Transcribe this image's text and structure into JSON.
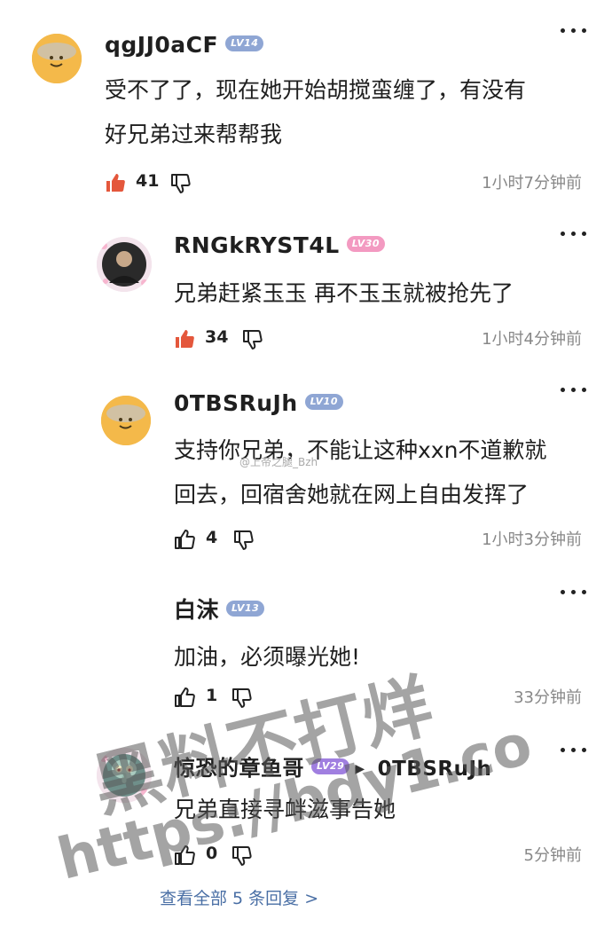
{
  "colors": {
    "lv14": "#8fa6d4",
    "lv30": "#f39ac1",
    "lv10": "#8fa6d4",
    "lv13": "#8fa6d4",
    "lv29": "#a07fe0",
    "like_active": "#e4573c",
    "link": "#4a6fa5"
  },
  "comments": [
    {
      "username": "qgJJ0aCF",
      "level": "LV14",
      "text": "受不了了，现在她开始胡搅蛮缠了，有没有\n好兄弟过来帮帮我",
      "likes": "41",
      "time": "1小时7分钟前",
      "liked": true,
      "avatar_icon": "smiley-avatar-icon"
    },
    {
      "username": "RNGkRYST4L",
      "level": "LV30",
      "text": "兄弟赶紧玉玉 再不玉玉就被抢先了",
      "likes": "34",
      "time": "1小时4分钟前",
      "liked": true,
      "avatar_icon": "photo-avatar-icon"
    },
    {
      "username": "0TBSRuJh",
      "level": "LV10",
      "text": "支持你兄弟，不能让这种xxn不道歉就\n回去，回宿舍她就在网上自由发挥了",
      "likes": "4",
      "time": "1小时3分钟前",
      "liked": false,
      "avatar_icon": "smiley-avatar-icon"
    },
    {
      "username": "白沫",
      "level": "LV13",
      "text": "加油，必须曝光她!",
      "likes": "1",
      "time": "33分钟前",
      "liked": false
    },
    {
      "username": "惊恐的章鱼哥",
      "level": "LV29",
      "reply_to": "0TBSRuJh",
      "text": "兄弟直接寻衅滋事告她",
      "likes": "0",
      "time": "5分钟前",
      "liked": false,
      "avatar_icon": "squidward-avatar-icon"
    }
  ],
  "view_all": "查看全部 5 条回复 >",
  "watermark_small": "@上帝之腿_Bzh",
  "watermark_line1": "黑料不打烊",
  "watermark_line2": "https://bdy1.co"
}
